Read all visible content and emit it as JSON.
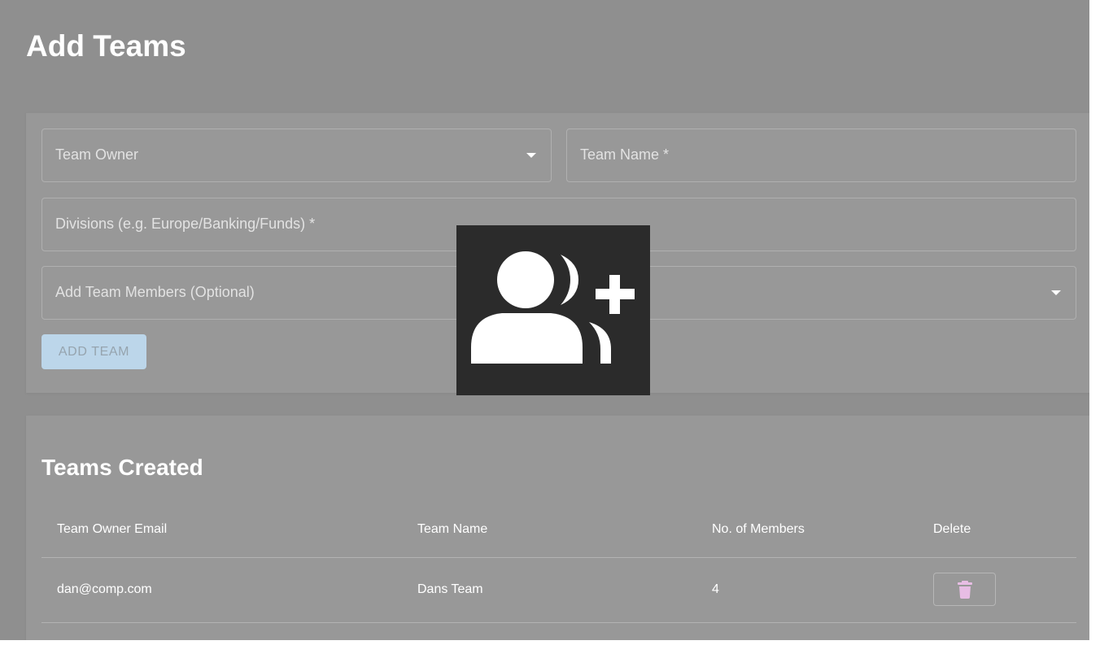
{
  "page": {
    "title": "Add Teams"
  },
  "form": {
    "team_owner_label": "Team Owner",
    "team_name_label": "Team Name *",
    "divisions_label": "Divisions (e.g. Europe/Banking/Funds) *",
    "members_label": "Add Team Members (Optional)",
    "add_button_label": "ADD TEAM"
  },
  "teams": {
    "title": "Teams Created",
    "columns": [
      "Team Owner Email",
      "Team Name",
      "No. of Members",
      "Delete"
    ],
    "rows": [
      {
        "email": "dan@comp.com",
        "name": "Dans Team",
        "members": "4"
      }
    ]
  },
  "icons": {
    "overlay": "group-add-icon",
    "dropdown": "chevron-down-icon",
    "delete": "trash-icon"
  },
  "colors": {
    "background": "#8f8f8f",
    "card": "#989898",
    "add_button": "#bcd6ea",
    "trash_icon": "#e7bde4",
    "overlay_bg": "#2b2b2b"
  }
}
